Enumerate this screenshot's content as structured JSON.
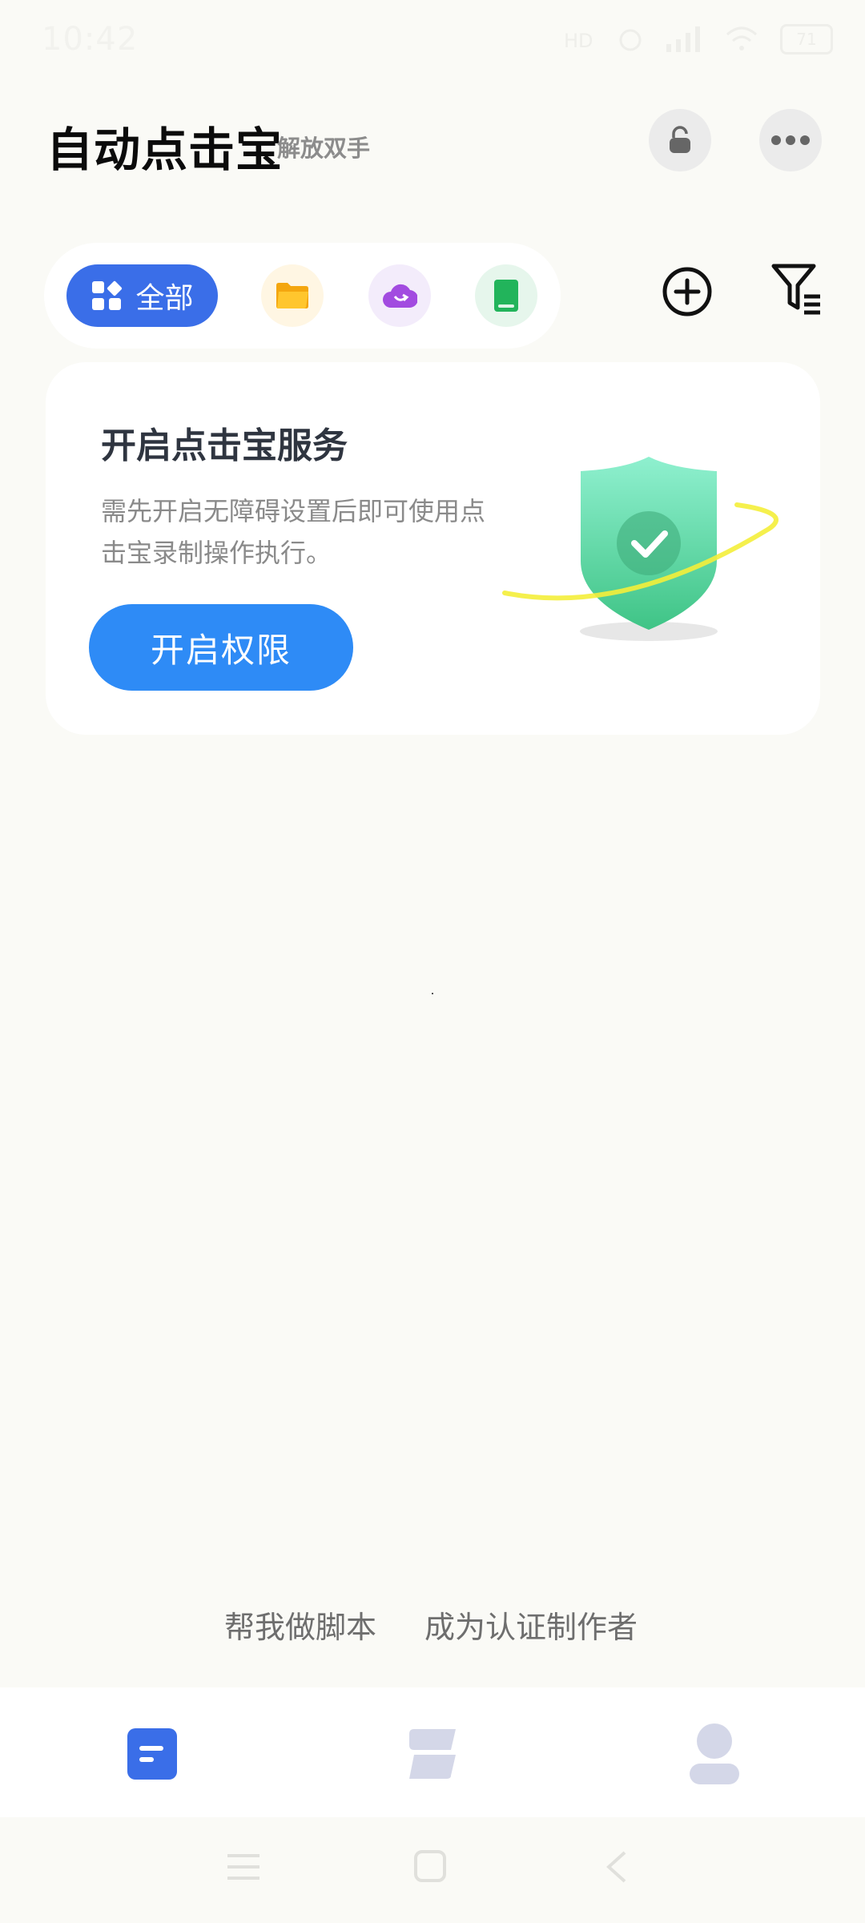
{
  "status_bar": {
    "time": "10:42",
    "battery": "71"
  },
  "header": {
    "title": "自动点击宝",
    "subtitle": "解放双手",
    "lock_icon": "lock-icon",
    "more_icon": "more-dots-icon"
  },
  "categories": {
    "all_label": "全部",
    "items": [
      "grid-icon",
      "folder-icon",
      "cloud-download-icon",
      "book-icon"
    ],
    "add_icon": "add-circle-icon",
    "filter_icon": "filter-icon"
  },
  "service_card": {
    "title": "开启点击宝服务",
    "description": "需先开启无障碍设置后即可使用点击宝录制操作执行。",
    "button_label": "开启权限",
    "illustration": "shield-check-icon"
  },
  "footer_links": {
    "help_label": "帮我做脚本",
    "author_label": "成为认证制作者"
  },
  "tab_bar": {
    "tabs": [
      "home-tab-icon",
      "market-tab-icon",
      "profile-tab-icon"
    ],
    "active_index": 0
  },
  "colors": {
    "accent": "#3A6EE8",
    "primary_button": "#2E8BF6",
    "background": "#FAFAF6",
    "shield": "#4FD49A"
  }
}
